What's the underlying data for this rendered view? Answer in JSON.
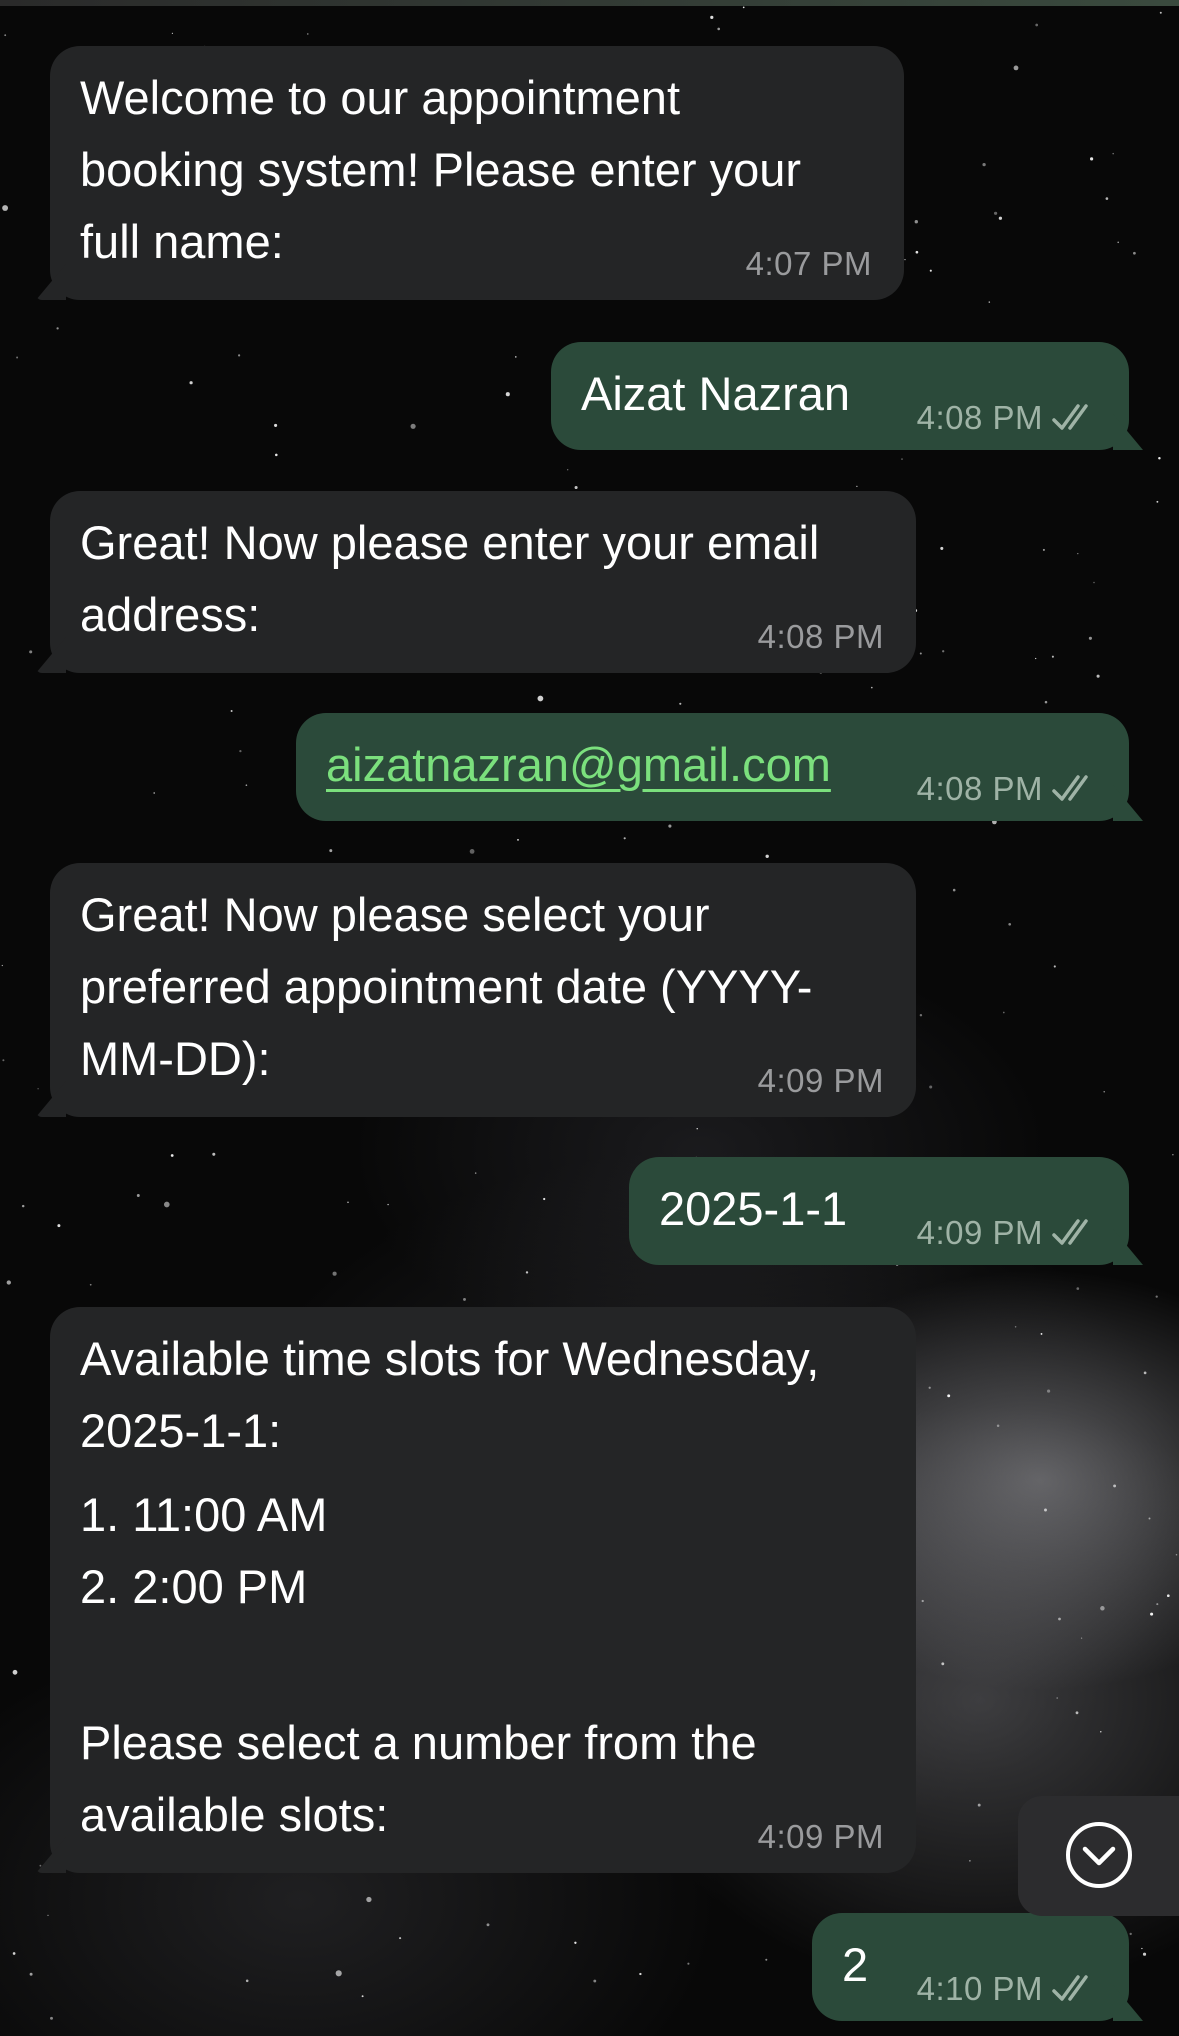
{
  "chat": {
    "messages": [
      {
        "direction": "incoming",
        "lines": [
          "Welcome to our appointment",
          "booking system! Please enter your",
          "full name:"
        ],
        "time": "4:07 PM"
      },
      {
        "direction": "outgoing",
        "text": "Aizat Nazran",
        "time": "4:08 PM",
        "status": "read"
      },
      {
        "direction": "incoming",
        "lines": [
          "Great! Now please enter your email",
          "address:"
        ],
        "time": "4:08 PM"
      },
      {
        "direction": "outgoing",
        "text": "aizatnazran@gmail.com",
        "time": "4:08 PM",
        "status": "read"
      },
      {
        "direction": "incoming",
        "lines": [
          "Great! Now please select your",
          "preferred appointment date (YYYY-",
          "MM-DD):"
        ],
        "time": "4:09 PM"
      },
      {
        "direction": "outgoing",
        "text": "2025-1-1",
        "time": "4:09 PM",
        "status": "read"
      },
      {
        "direction": "incoming",
        "lines": [
          "Available time slots for Wednesday,",
          "2025-1-1:",
          "1. 11:00 AM",
          "2. 2:00 PM",
          "Please select a number from the",
          "available slots:"
        ],
        "time": "4:09 PM"
      },
      {
        "direction": "outgoing",
        "text": "2",
        "time": "4:10 PM",
        "status": "read"
      }
    ]
  },
  "scroll_button": {
    "icon": "chevron-down-circle-icon"
  },
  "colors": {
    "incoming_bubble": "#242526",
    "outgoing_bubble": "#2b4a3a",
    "link": "#7be07d",
    "background": "#080808"
  }
}
